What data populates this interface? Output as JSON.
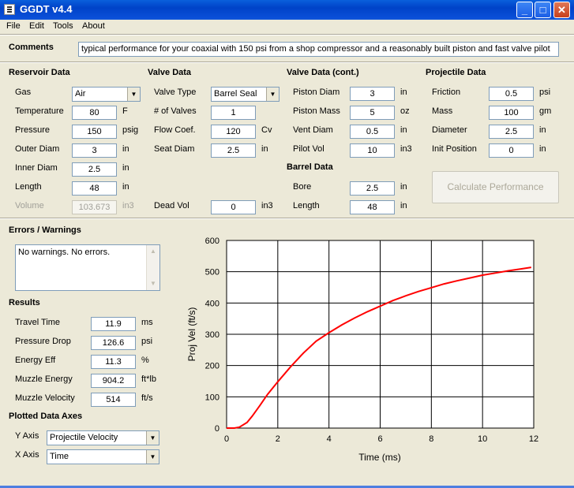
{
  "window": {
    "title": "GGDT v4.4"
  },
  "menu": [
    "File",
    "Edit",
    "Tools",
    "About"
  ],
  "comments": {
    "label": "Comments",
    "value": "typical performance for your coaxial with 150 psi from a shop compressor and a reasonably built piston and fast valve pilot"
  },
  "reservoir": {
    "heading": "Reservoir Data",
    "gas": {
      "label": "Gas",
      "value": "Air"
    },
    "temperature": {
      "label": "Temperature",
      "value": "80",
      "unit": "F"
    },
    "pressure": {
      "label": "Pressure",
      "value": "150",
      "unit": "psig"
    },
    "outer_diam": {
      "label": "Outer Diam",
      "value": "3",
      "unit": "in"
    },
    "inner_diam": {
      "label": "Inner Diam",
      "value": "2.5",
      "unit": "in"
    },
    "length": {
      "label": "Length",
      "value": "48",
      "unit": "in"
    },
    "volume": {
      "label": "Volume",
      "value": "103.673",
      "unit": "in3"
    }
  },
  "valve": {
    "heading": "Valve Data",
    "type": {
      "label": "Valve Type",
      "value": "Barrel Seal"
    },
    "num_valves": {
      "label": "# of Valves",
      "value": "1"
    },
    "flow_coef": {
      "label": "Flow Coef.",
      "value": "120",
      "unit": "Cv"
    },
    "seat_diam": {
      "label": "Seat Diam",
      "value": "2.5",
      "unit": "in"
    },
    "dead_vol": {
      "label": "Dead Vol",
      "value": "0",
      "unit": "in3"
    }
  },
  "valve_cont": {
    "heading": "Valve Data (cont.)",
    "piston_diam": {
      "label": "Piston Diam",
      "value": "3",
      "unit": "in"
    },
    "piston_mass": {
      "label": "Piston Mass",
      "value": "5",
      "unit": "oz"
    },
    "vent_diam": {
      "label": "Vent Diam",
      "value": "0.5",
      "unit": "in"
    },
    "pilot_vol": {
      "label": "Pilot Vol",
      "value": "10",
      "unit": "in3"
    }
  },
  "barrel": {
    "heading": "Barrel Data",
    "bore": {
      "label": "Bore",
      "value": "2.5",
      "unit": "in"
    },
    "length": {
      "label": "Length",
      "value": "48",
      "unit": "in"
    }
  },
  "projectile": {
    "heading": "Projectile Data",
    "friction": {
      "label": "Friction",
      "value": "0.5",
      "unit": "psi"
    },
    "mass": {
      "label": "Mass",
      "value": "100",
      "unit": "gm"
    },
    "diameter": {
      "label": "Diameter",
      "value": "2.5",
      "unit": "in"
    },
    "init_position": {
      "label": "Init Position",
      "value": "0",
      "unit": "in"
    }
  },
  "calculate_label": "Calculate Performance",
  "errors": {
    "heading": "Errors / Warnings",
    "text": "No warnings.  No errors."
  },
  "results": {
    "heading": "Results",
    "travel_time": {
      "label": "Travel Time",
      "value": "11.9",
      "unit": "ms"
    },
    "pressure_drop": {
      "label": "Pressure Drop",
      "value": "126.6",
      "unit": "psi"
    },
    "energy_eff": {
      "label": "Energy Eff",
      "value": "11.3",
      "unit": "%"
    },
    "muzzle_energy": {
      "label": "Muzzle Energy",
      "value": "904.2",
      "unit": "ft*lb"
    },
    "muzzle_velocity": {
      "label": "Muzzle Velocity",
      "value": "514",
      "unit": "ft/s"
    }
  },
  "axes": {
    "heading": "Plotted Data Axes",
    "y_axis": {
      "label": "Y Axis",
      "value": "Projectile Velocity"
    },
    "x_axis": {
      "label": "X Axis",
      "value": "Time"
    }
  },
  "colors": {
    "curve": "#ff0000",
    "title_bar": "#0a4fd8"
  },
  "chart_data": {
    "type": "line",
    "xlabel": "Time (ms)",
    "ylabel": "Proj Vel (ft/s)",
    "xlim": [
      0,
      12
    ],
    "ylim": [
      0,
      600
    ],
    "xticks": [
      0,
      2,
      4,
      6,
      8,
      10,
      12
    ],
    "yticks": [
      0,
      100,
      200,
      300,
      400,
      500,
      600
    ],
    "grid": true,
    "series": [
      {
        "x": [
          0,
          0.3,
          0.5,
          0.8,
          1.0,
          1.3,
          1.6,
          2.0,
          2.5,
          3.0,
          3.5,
          4.0,
          4.5,
          5.0,
          5.5,
          6.0,
          6.5,
          7.0,
          7.5,
          8.0,
          8.5,
          9.0,
          9.5,
          10.0,
          10.5,
          11.0,
          11.5,
          11.9
        ],
        "y": [
          0,
          0,
          3,
          18,
          38,
          72,
          108,
          148,
          196,
          240,
          278,
          305,
          330,
          352,
          372,
          390,
          408,
          423,
          437,
          449,
          461,
          471,
          480,
          489,
          496,
          503,
          509,
          514
        ]
      }
    ]
  }
}
